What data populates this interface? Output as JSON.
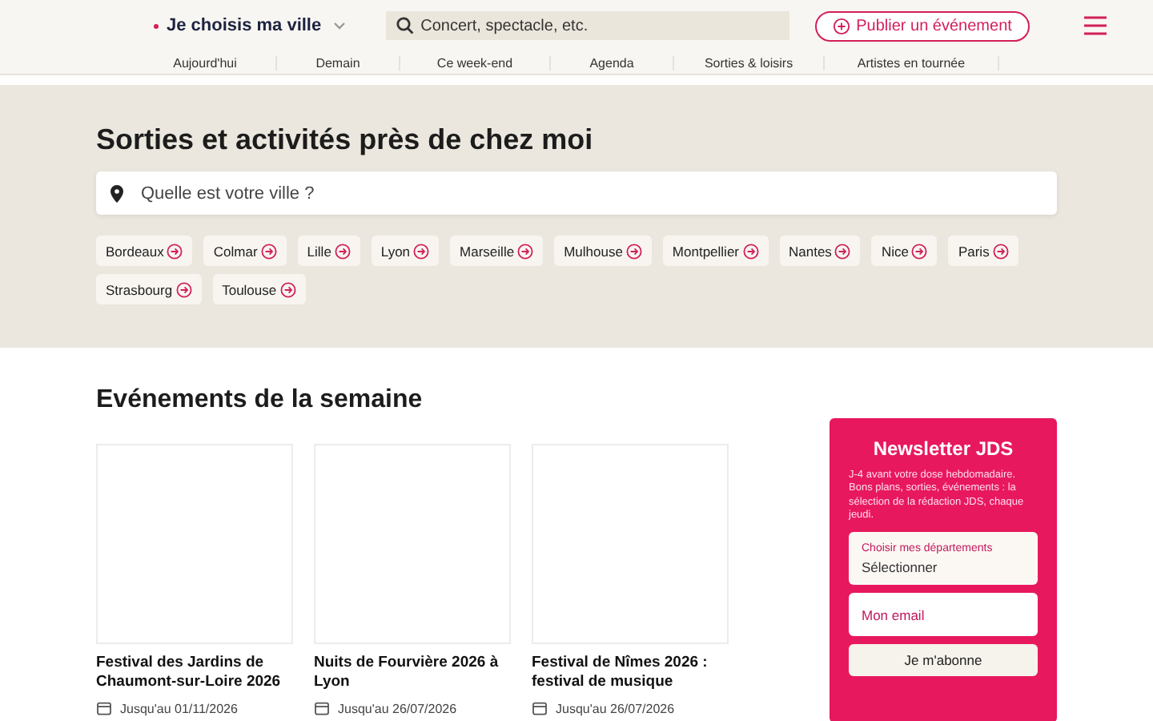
{
  "header": {
    "city_selector": "Je choisis ma ville",
    "search": {
      "placeholder": "Concert, spectacle, etc."
    },
    "publish_button": "Publier un événement"
  },
  "nav": [
    "Aujourd'hui",
    "Demain",
    "Ce week-end",
    "Agenda",
    "Sorties & loisirs",
    "Artistes en tournée"
  ],
  "hero": {
    "title": "Sorties et activités près de chez moi",
    "city_search": {
      "placeholder": "Quelle est votre ville ?"
    },
    "cities": [
      "Bordeaux",
      "Colmar",
      "Lille",
      "Lyon",
      "Marseille",
      "Mulhouse",
      "Montpellier",
      "Nantes",
      "Nice",
      "Paris",
      "Strasbourg",
      "Toulouse"
    ]
  },
  "events": {
    "title": "Evénements de la semaine",
    "items": [
      {
        "title": "Festival des Jardins de Chaumont-sur-Loire 2026",
        "date": "Jusqu'au 01/11/2026"
      },
      {
        "title": "Nuits de Fourvière 2026 à Lyon",
        "date": "Jusqu'au 26/07/2026"
      },
      {
        "title": "Festival de Nîmes 2026 : festival de musique",
        "date": "Jusqu'au 26/07/2026"
      }
    ]
  },
  "newsletter": {
    "title": "Newsletter JDS",
    "text": "J-4 avant votre dose hebdomadaire. Bons plans, sorties, événements : la sélection de la rédaction JDS, chaque jeudi.",
    "departments": {
      "label": "Choisir mes départements",
      "value": "Sélectionner"
    },
    "email": {
      "placeholder": "Mon email"
    },
    "button": "Je m'abonne"
  }
}
